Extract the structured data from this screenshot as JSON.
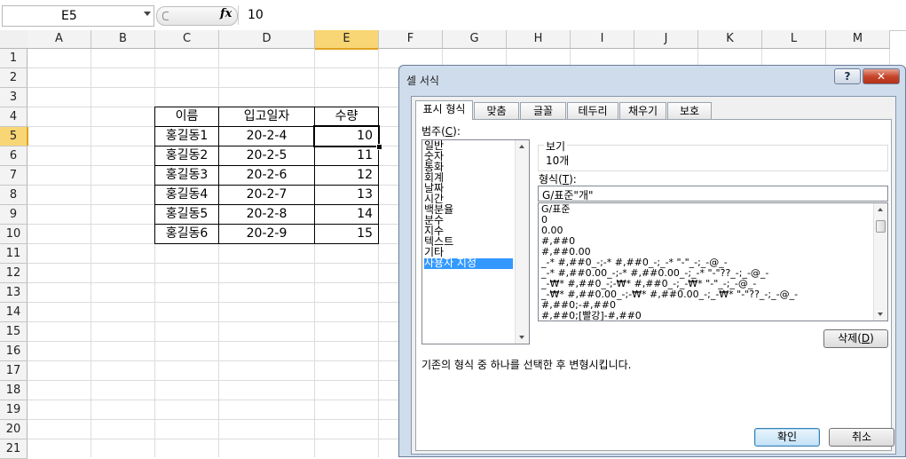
{
  "formula_bar": {
    "name_box": "E5",
    "fx_label": "fx",
    "value": "10"
  },
  "columns": [
    "A",
    "B",
    "C",
    "D",
    "E",
    "F",
    "G",
    "H",
    "I",
    "J",
    "K",
    "L",
    "M"
  ],
  "rows": [
    "1",
    "2",
    "3",
    "4",
    "5",
    "6",
    "7",
    "8",
    "9",
    "10",
    "11",
    "12",
    "13",
    "14",
    "15",
    "16",
    "17",
    "18",
    "19",
    "20",
    "21"
  ],
  "selected": {
    "column": "E",
    "row": "5"
  },
  "table": {
    "headers": [
      "이름",
      "입고일자",
      "수량"
    ],
    "rows": [
      [
        "홍길동1",
        "20-2-4",
        "10"
      ],
      [
        "홍길동2",
        "20-2-5",
        "11"
      ],
      [
        "홍길동3",
        "20-2-6",
        "12"
      ],
      [
        "홍길동4",
        "20-2-7",
        "13"
      ],
      [
        "홍길동5",
        "20-2-8",
        "14"
      ],
      [
        "홍길동6",
        "20-2-9",
        "15"
      ]
    ]
  },
  "dialog": {
    "title": "셀 서식",
    "help_label": "?",
    "close_label": "✕",
    "tabs": [
      "표시 형식",
      "맞춤",
      "글꼴",
      "테두리",
      "채우기",
      "보호"
    ],
    "active_tab": 0,
    "category_label": "범주(",
    "category_key": "C",
    "category_label_end": "):",
    "categories": [
      "일반",
      "숫자",
      "통화",
      "회계",
      "날짜",
      "시간",
      "백분율",
      "분수",
      "지수",
      "텍스트",
      "기타",
      "사용자 지정"
    ],
    "selected_category": 11,
    "preview_label": "보기",
    "preview_value": "10개",
    "type_label": "형식(",
    "type_key": "T",
    "type_label_end": "):",
    "type_value": "G/표준\"개\"",
    "formats": [
      "G/표준",
      "0",
      "0.00",
      "#,##0",
      "#,##0.00",
      "_-* #,##0_-;-* #,##0_-;_-* \"-\"_-;_-@_-",
      "_-* #,##0.00_-;-* #,##0.00_-;_-* \"-\"??_-;_-@_-",
      "_-₩* #,##0_-;-₩* #,##0_-;_-₩* \"-\"_-;_-@_-",
      "_-₩* #,##0.00_-;-₩* #,##0.00_-;_-₩* \"-\"??_-;_-@_-",
      "#,##0;-#,##0",
      "#,##0;[빨강]-#,##0"
    ],
    "delete_label": "삭제(",
    "delete_key": "D",
    "delete_label_end": ")",
    "description": "기존의 형식 중 하나를 선택한 후 변형시킵니다.",
    "ok_label": "확인",
    "cancel_label": "취소"
  }
}
